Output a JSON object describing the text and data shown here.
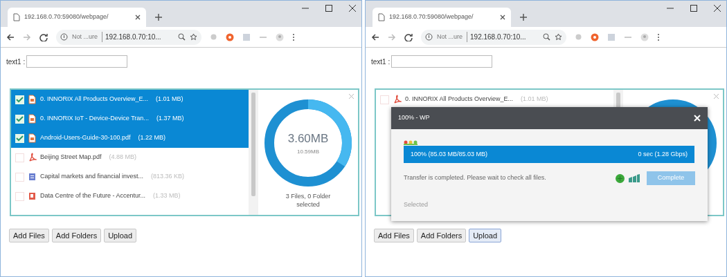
{
  "windows": [
    {
      "tab": {
        "title": "192.168.0.70:59080/webpage/"
      },
      "address": {
        "security": "Not ...ure",
        "url": "192.168.0.70:10..."
      },
      "form": {
        "label": "text1 :"
      },
      "files": [
        {
          "name": "0. INNORIX All Products Overview_E...",
          "size": "(1.01 MB)",
          "kind": "pdf",
          "checked": true,
          "selected": true
        },
        {
          "name": "0. INNORIX IoT - Device-Device Tran...",
          "size": "(1.37 MB)",
          "kind": "pdf",
          "checked": true,
          "selected": true
        },
        {
          "name": "Android-Users-Guide-30-100.pdf",
          "size": "(1.22 MB)",
          "kind": "pdf",
          "checked": true,
          "selected": true
        },
        {
          "name": "Beijing Street Map.pdf",
          "size": "(4.88 MB)",
          "kind": "acrobat",
          "checked": false,
          "selected": false
        },
        {
          "name": "Capital markets and financial invest...",
          "size": "(813.36 KB)",
          "kind": "doc",
          "checked": false,
          "selected": false
        },
        {
          "name": "Data Centre of the Future - Accentur...",
          "size": "(1.33 MB)",
          "kind": "ppt",
          "checked": false,
          "selected": false
        }
      ],
      "summary": {
        "selected_size": "3.60MB",
        "total_size": "10.59MB",
        "level": 0.34,
        "caption": "3 Files, 0 Folder selected"
      },
      "buttons": [
        {
          "label": "Add Files",
          "focused": false
        },
        {
          "label": "Add Folders",
          "focused": false
        },
        {
          "label": "Upload",
          "focused": false
        }
      ]
    },
    {
      "tab": {
        "title": "192.168.0.70:59080/webpage/"
      },
      "address": {
        "security": "Not ...ure",
        "url": "192.168.0.70:10..."
      },
      "form": {
        "label": "text1 :"
      },
      "files": [
        {
          "name": "0. INNORIX All Products Overview_E...",
          "size": "(1.01 MB)",
          "kind": "acrobat",
          "checked": false,
          "selected": false
        }
      ],
      "buttons": [
        {
          "label": "Add Files",
          "focused": false
        },
        {
          "label": "Add Folders",
          "focused": false
        },
        {
          "label": "Upload",
          "focused": true
        }
      ],
      "dialog": {
        "title": "100% - WP",
        "progress": {
          "level": 1,
          "text": "100% (85.03 MB/85.03 MB)",
          "time": "0 sec (1.28 Gbps)"
        },
        "message": "Transfer is completed. Please wait to check all files.",
        "button": "Complete",
        "footer": "Selected"
      }
    }
  ]
}
